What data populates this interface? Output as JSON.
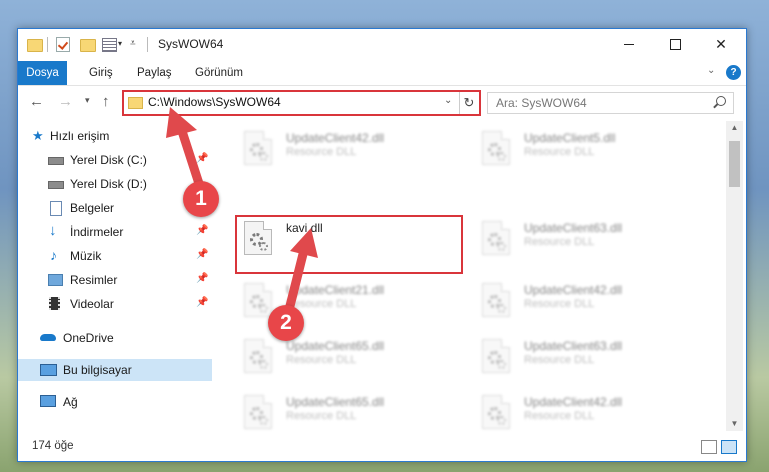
{
  "window": {
    "title": "SysWOW64",
    "minimize": "—",
    "maximize": "☐",
    "close": "✕"
  },
  "ribbon": {
    "tabs": [
      "Dosya",
      "Giriş",
      "Paylaş",
      "Görünüm"
    ]
  },
  "address": {
    "path": "C:\\Windows\\SysWOW64",
    "search_placeholder": "Ara: SysWOW64"
  },
  "sidebar": {
    "items": [
      {
        "label": "Hızlı erişim",
        "icon": "star-icon"
      },
      {
        "label": "Yerel Disk (C:)",
        "icon": "drive-icon",
        "pinned": true
      },
      {
        "label": "Yerel Disk (D:)",
        "icon": "drive-icon"
      },
      {
        "label": "Belgeler",
        "icon": "documents-icon",
        "pinned": true
      },
      {
        "label": "İndirmeler",
        "icon": "download-icon",
        "pinned": true
      },
      {
        "label": "Müzik",
        "icon": "music-icon",
        "pinned": true
      },
      {
        "label": "Resimler",
        "icon": "pictures-icon",
        "pinned": true
      },
      {
        "label": "Videolar",
        "icon": "videos-icon",
        "pinned": true
      },
      {
        "label": "OneDrive",
        "icon": "onedrive-icon"
      },
      {
        "label": "Bu bilgisayar",
        "icon": "computer-icon",
        "selected": true
      },
      {
        "label": "Ağ",
        "icon": "network-icon"
      }
    ]
  },
  "files": [
    {
      "name": "UpdateClient42.dll",
      "type": "Resource DLL"
    },
    {
      "name": "UpdateClient5.dll",
      "type": "Resource DLL"
    },
    {
      "name": "kavi.dll",
      "type": ""
    },
    {
      "name": "UpdateClient63.dll",
      "type": "Resource DLL"
    },
    {
      "name": "UpdateClient21.dll",
      "type": "Resource DLL"
    },
    {
      "name": "UpdateClient42.dll",
      "type": "Resource DLL"
    },
    {
      "name": "UpdateClient65.dll",
      "type": "Resource DLL"
    },
    {
      "name": "UpdateClient63.dll",
      "type": "Resource DLL"
    },
    {
      "name": "UpdateClient65.dll",
      "type": "Resource DLL"
    },
    {
      "name": "UpdateClient42.dll",
      "type": "Resource DLL"
    }
  ],
  "status": {
    "item_count": "174 öğe"
  },
  "callouts": [
    "1",
    "2"
  ],
  "colors": {
    "accent": "#1979ca",
    "callout": "#e84649",
    "highlight_border": "#d9353b"
  }
}
